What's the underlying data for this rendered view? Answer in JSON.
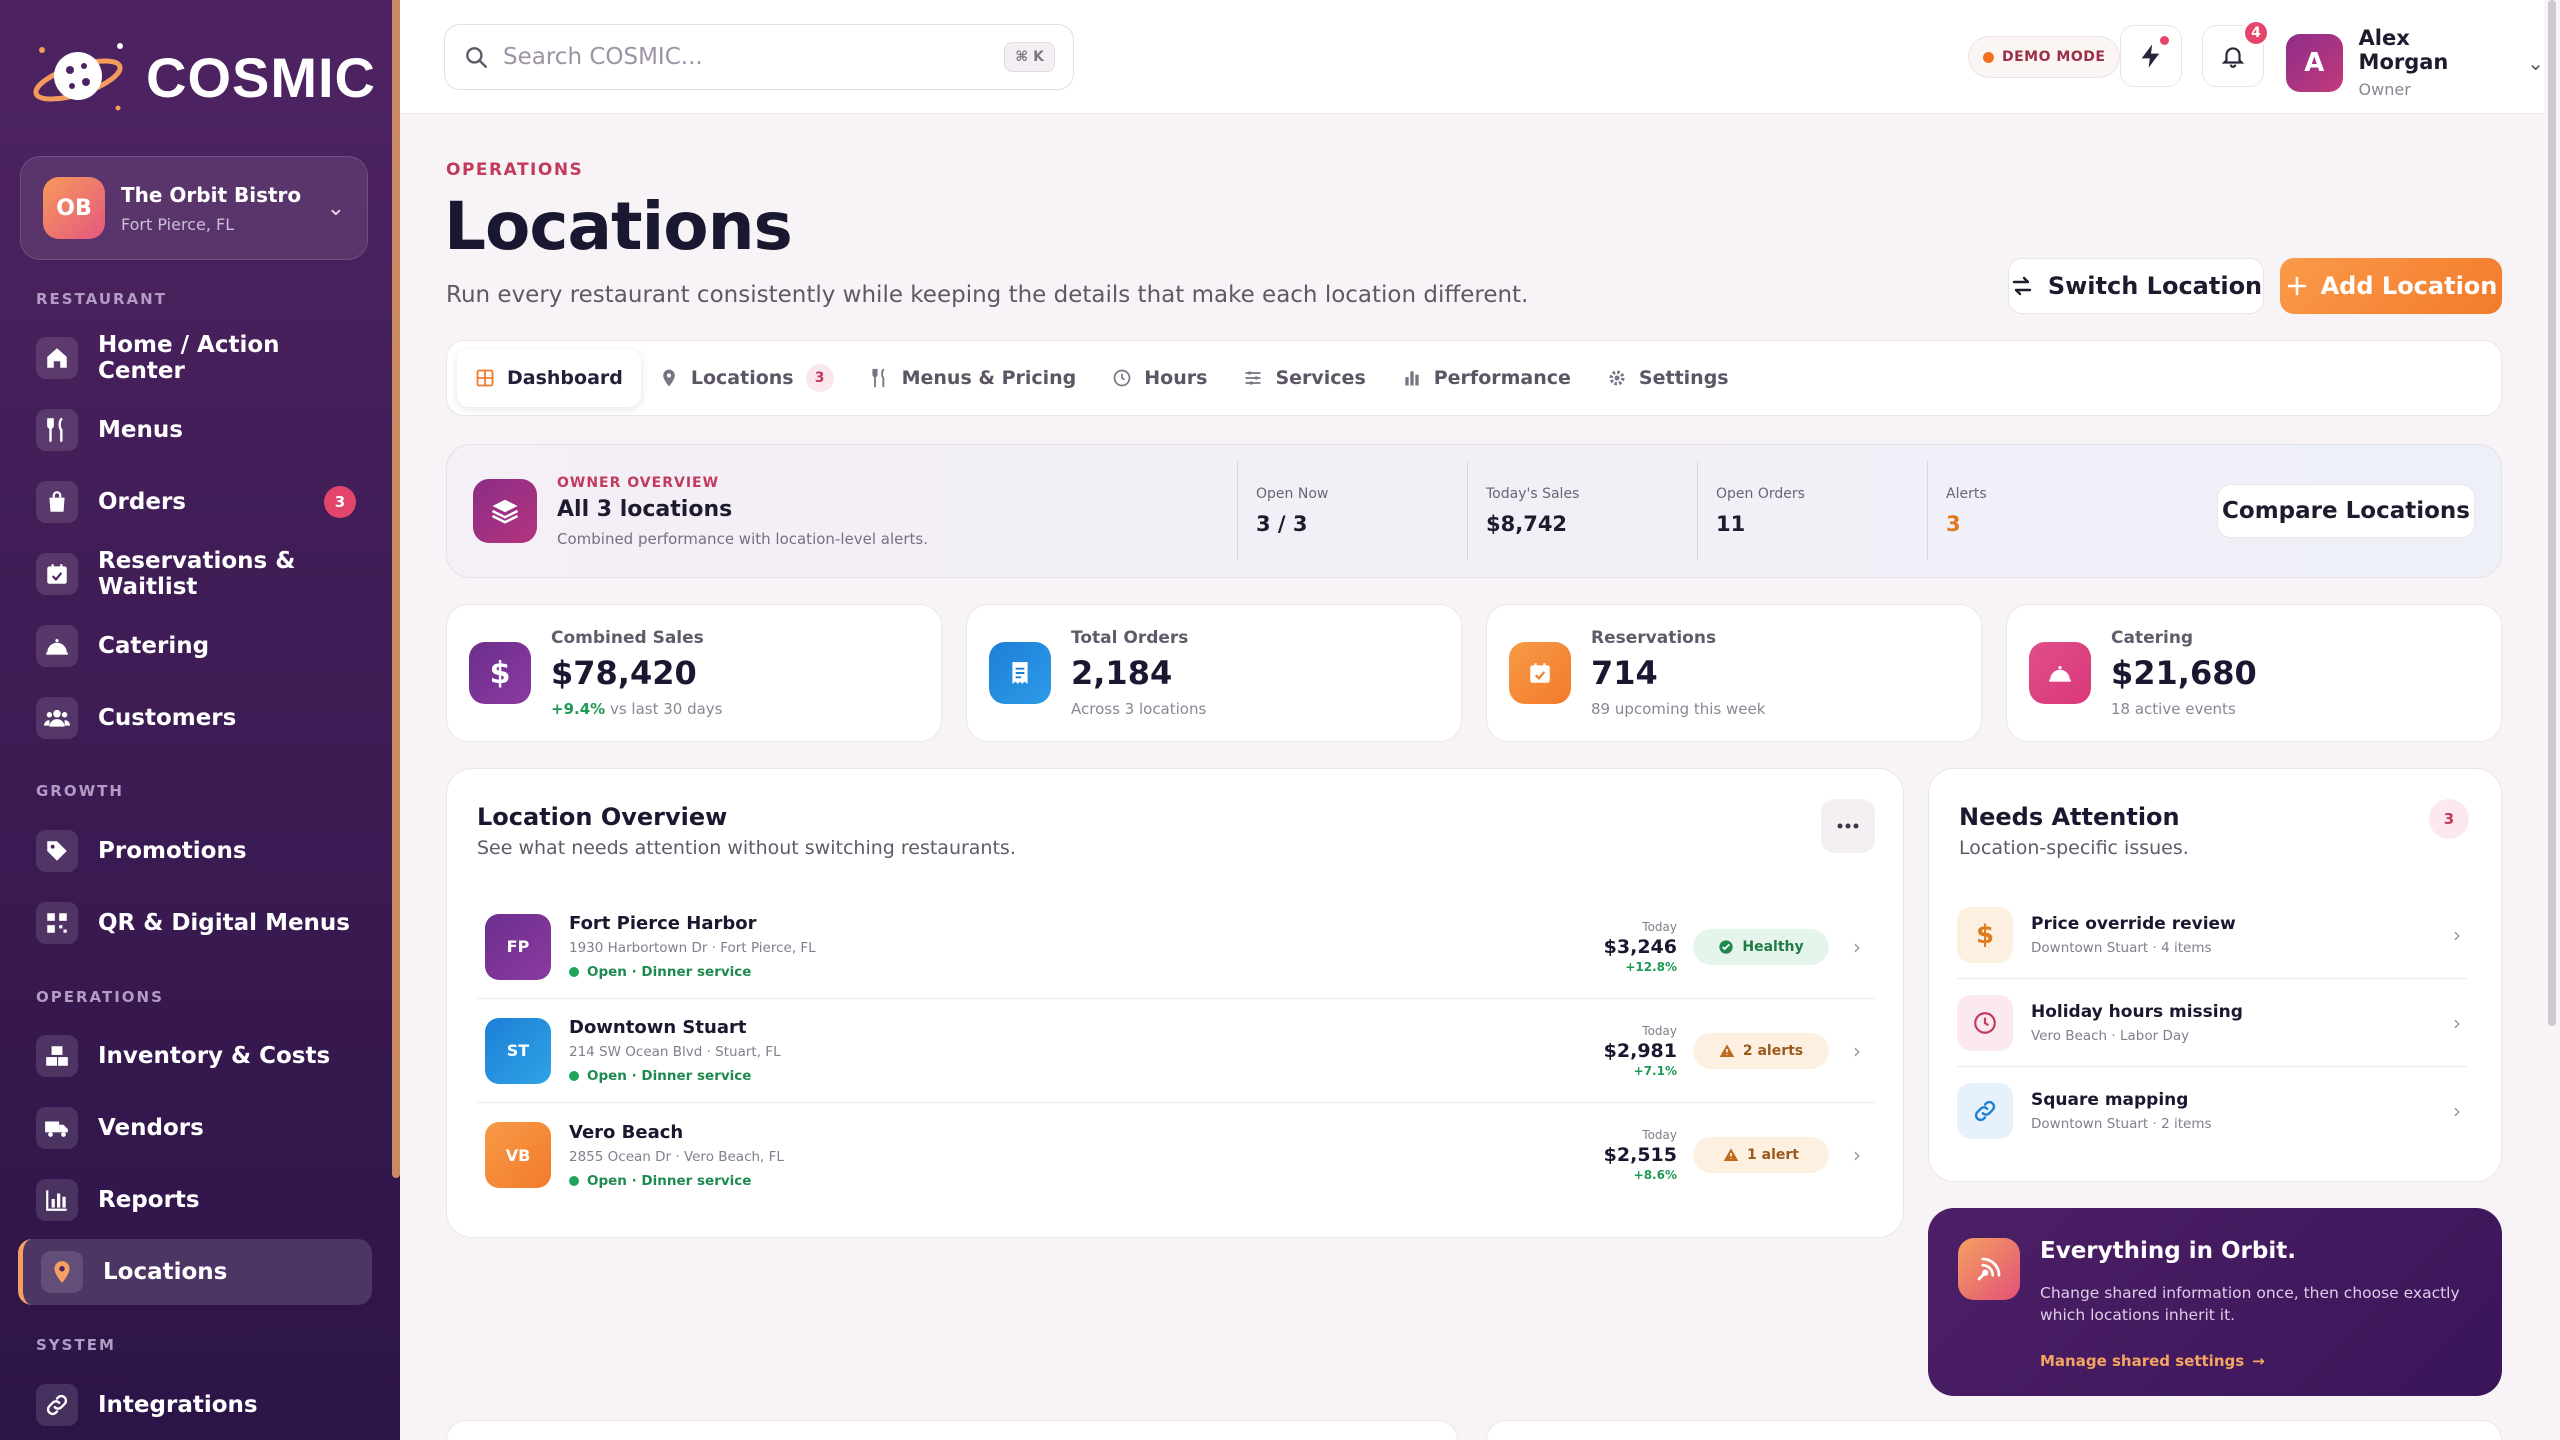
{
  "brand": {
    "name": "COSMIC"
  },
  "location_switcher": {
    "initials": "OB",
    "name": "The Orbit Bistro",
    "city": "Fort Pierce, FL"
  },
  "nav": {
    "sections": {
      "restaurant": "RESTAURANT",
      "growth": "GROWTH",
      "operations": "OPERATIONS",
      "system": "SYSTEM"
    },
    "items": {
      "home": "Home / Action Center",
      "menus": "Menus",
      "orders": "Orders",
      "orders_badge": "3",
      "reservations": "Reservations & Waitlist",
      "catering": "Catering",
      "customers": "Customers",
      "promotions": "Promotions",
      "qr": "QR & Digital Menus",
      "inventory": "Inventory & Costs",
      "vendors": "Vendors",
      "reports": "Reports",
      "locations": "Locations",
      "integrations": "Integrations"
    }
  },
  "topbar": {
    "search_placeholder": "Search COSMIC...",
    "shortcut": "⌘ K",
    "demo_mode": "DEMO MODE",
    "notifications_count": "4",
    "user": {
      "initial": "A",
      "name": "Alex Morgan",
      "role": "Owner"
    }
  },
  "page": {
    "eyebrow": "OPERATIONS",
    "title": "Locations",
    "subtitle": "Run every restaurant consistently while keeping the details that make each location different.",
    "switch_label": "Switch Location",
    "add_label": "Add Location"
  },
  "tabs": {
    "dashboard": "Dashboard",
    "locations": "Locations",
    "locations_count": "3",
    "menus": "Menus & Pricing",
    "hours": "Hours",
    "services": "Services",
    "performance": "Performance",
    "settings": "Settings"
  },
  "owner_overview": {
    "eyebrow": "OWNER OVERVIEW",
    "title": "All 3 locations",
    "sub": "Combined performance with location-level alerts.",
    "stats": [
      {
        "label": "Open Now",
        "value": "3 / 3"
      },
      {
        "label": "Today's Sales",
        "value": "$8,742"
      },
      {
        "label": "Open Orders",
        "value": "11"
      },
      {
        "label": "Alerts",
        "value": "3"
      }
    ],
    "compare_label": "Compare Locations"
  },
  "kpis": [
    {
      "label": "Combined Sales",
      "value": "$78,420",
      "delta": "+9.4%",
      "sub": " vs last 30 days"
    },
    {
      "label": "Total Orders",
      "value": "2,184",
      "sub": "Across 3 locations"
    },
    {
      "label": "Reservations",
      "value": "714",
      "sub": "89 upcoming this week"
    },
    {
      "label": "Catering",
      "value": "$21,680",
      "sub": "18 active events"
    }
  ],
  "location_overview": {
    "title": "Location Overview",
    "sub": "See what needs attention without switching restaurants.",
    "rows": [
      {
        "initials": "FP",
        "name": "Fort Pierce Harbor",
        "address": "1930 Harbortown Dr · Fort Pierce, FL",
        "status": "Open · Dinner service",
        "today_label": "Today",
        "sales": "$3,246",
        "delta": "+12.8%",
        "pill": "Healthy"
      },
      {
        "initials": "ST",
        "name": "Downtown Stuart",
        "address": "214 SW Ocean Blvd · Stuart, FL",
        "status": "Open · Dinner service",
        "today_label": "Today",
        "sales": "$2,981",
        "delta": "+7.1%",
        "pill": "2 alerts"
      },
      {
        "initials": "VB",
        "name": "Vero Beach",
        "address": "2855 Ocean Dr · Vero Beach, FL",
        "status": "Open · Dinner service",
        "today_label": "Today",
        "sales": "$2,515",
        "delta": "+8.6%",
        "pill": "1 alert"
      }
    ]
  },
  "needs_attention": {
    "title": "Needs Attention",
    "sub": "Location-specific issues.",
    "count": "3",
    "items": [
      {
        "title": "Price override review",
        "sub": "Downtown Stuart · 4 items"
      },
      {
        "title": "Holiday hours missing",
        "sub": "Vero Beach · Labor Day"
      },
      {
        "title": "Square mapping",
        "sub": "Downtown Stuart · 2 items"
      }
    ]
  },
  "orbit_card": {
    "title": "Everything in Orbit.",
    "text": "Change shared information once, then choose exactly which locations inherit it.",
    "link": "Manage shared settings"
  },
  "colors": {
    "accent": "#f27b2b",
    "brand_purple": "#4e2362",
    "alert": "#e4456c",
    "success": "#22a35a"
  }
}
